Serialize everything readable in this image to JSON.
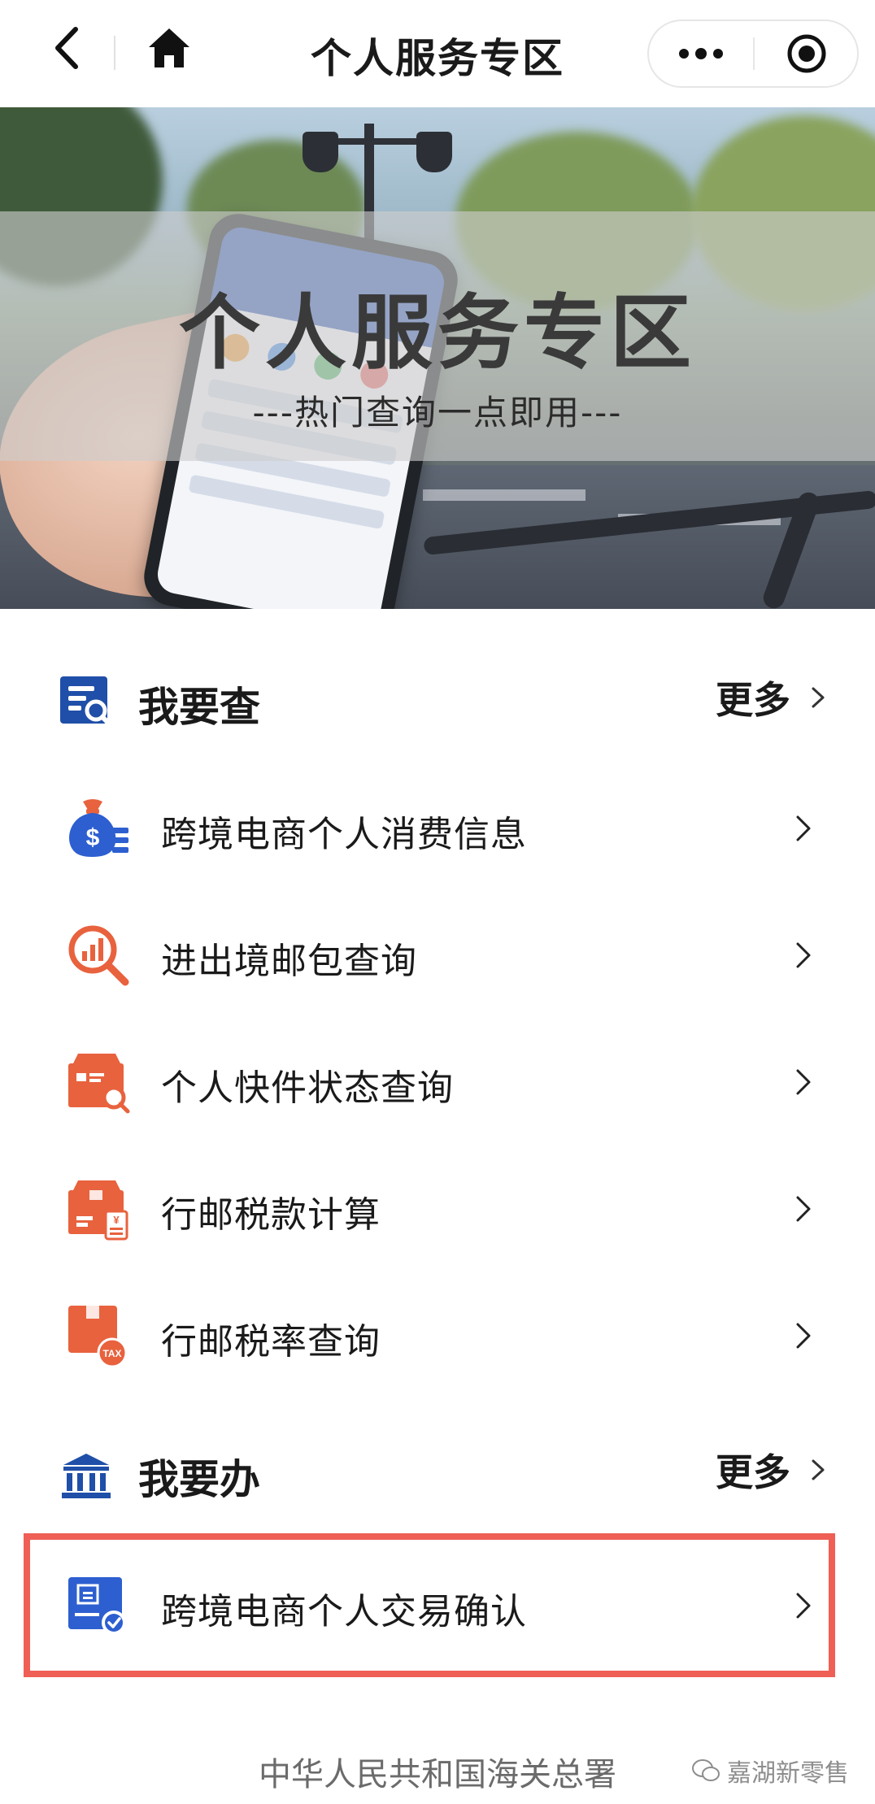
{
  "navbar": {
    "title": "个人服务专区",
    "back_icon": "chevron-left-icon",
    "home_icon": "home-icon",
    "more_icon": "more-dots-icon",
    "target_icon": "target-icon"
  },
  "banner": {
    "title": "个人服务专区",
    "subtitle": "---热门查询一点即用---"
  },
  "sections": {
    "query": {
      "title": "我要查",
      "more_label": "更多",
      "icon": "document-search-icon",
      "items": [
        {
          "label": "跨境电商个人消费信息",
          "icon": "money-bag-icon"
        },
        {
          "label": "进出境邮包查询",
          "icon": "chart-magnifier-icon"
        },
        {
          "label": "个人快件状态查询",
          "icon": "parcel-search-icon"
        },
        {
          "label": "行邮税款计算",
          "icon": "parcel-calculator-icon"
        },
        {
          "label": "行邮税率查询",
          "icon": "parcel-tax-icon"
        }
      ]
    },
    "handle": {
      "title": "我要办",
      "more_label": "更多",
      "icon": "bank-building-icon",
      "items": [
        {
          "label": "跨境电商个人交易确认",
          "icon": "id-card-check-icon"
        }
      ]
    }
  },
  "footer": {
    "text": "中华人民共和国海关总署"
  },
  "watermark": {
    "text": "嘉湖新零售"
  },
  "colors": {
    "accent_blue": "#2d5fd0",
    "accent_orange": "#e8623e",
    "highlight_red": "#ef5f55"
  }
}
